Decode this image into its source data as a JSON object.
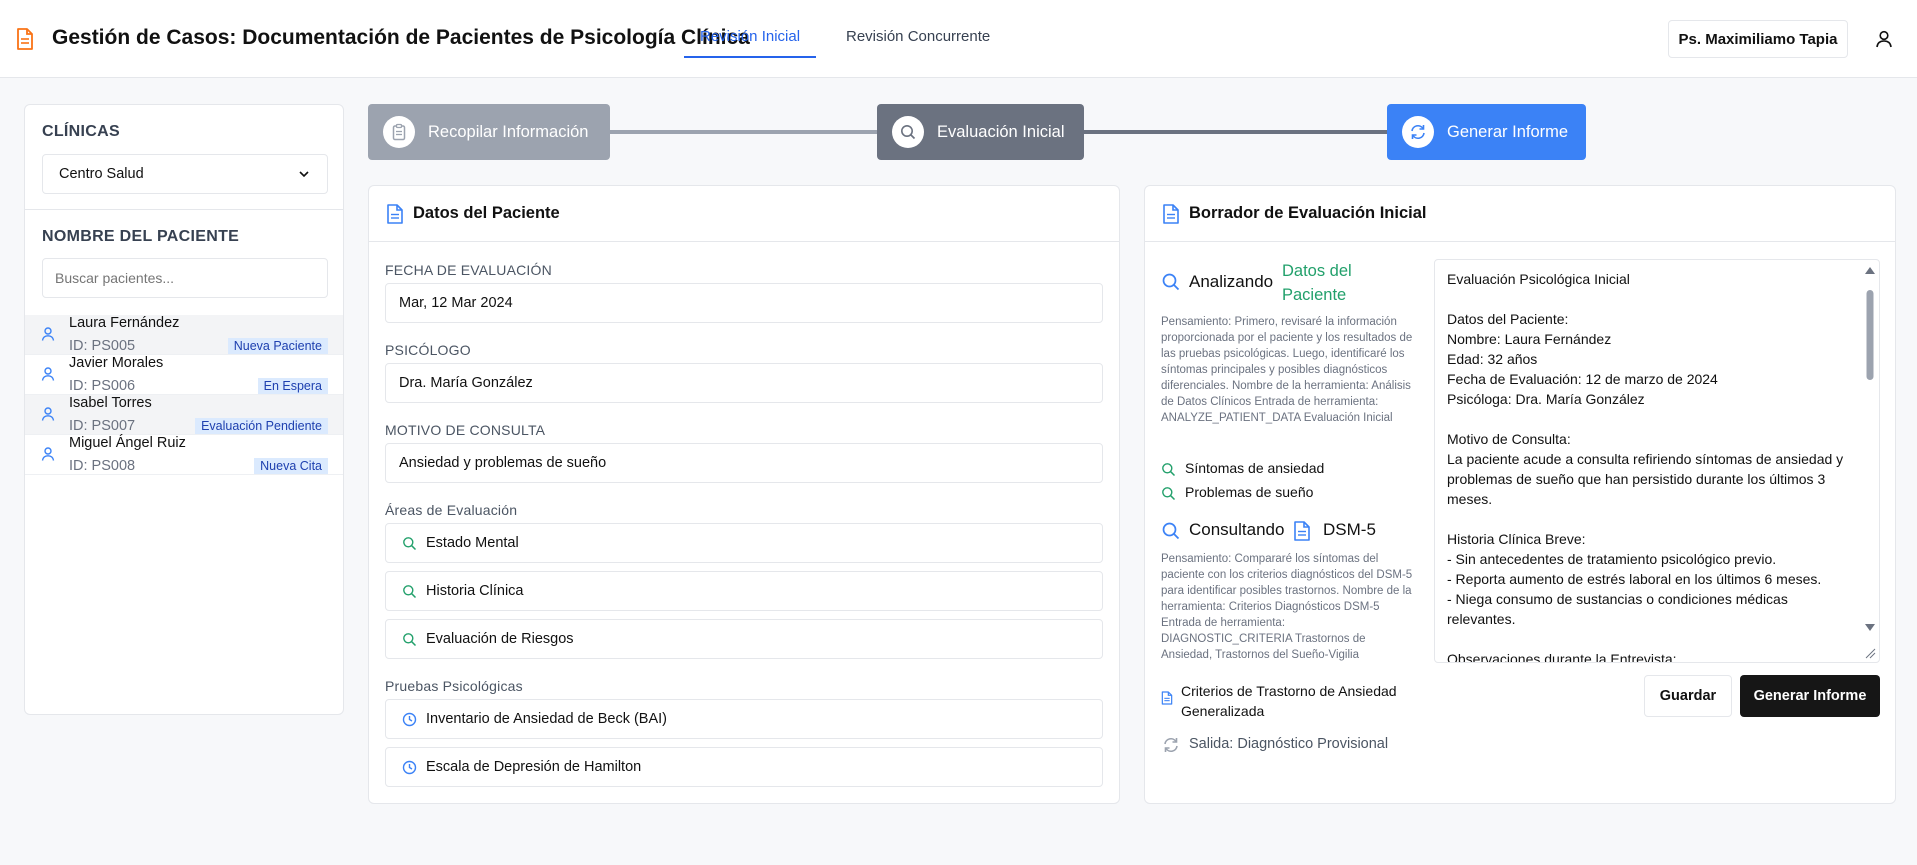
{
  "header": {
    "title": "Gestión de Casos: Documentación de Pacientes de Psicología Clínica",
    "tabs": [
      {
        "label": "Revisión Inicial",
        "active": true
      },
      {
        "label": "Revisión Concurrente",
        "active": false
      }
    ],
    "user_label": "Ps. Maximiliamo Tapia",
    "icons": {
      "app": "document-icon",
      "user": "user-icon"
    }
  },
  "sidebar": {
    "clinics_heading": "CLÍNICAS",
    "clinic_selected": "Centro Salud",
    "patient_heading": "NOMBRE DEL PACIENTE",
    "search_placeholder": "Buscar pacientes...",
    "patients": [
      {
        "name": "Laura Fernández",
        "id": "ID: PS005",
        "status": "Nueva Paciente"
      },
      {
        "name": "Javier Morales",
        "id": "ID: PS006",
        "status": "En Espera"
      },
      {
        "name": "Isabel Torres",
        "id": "ID: PS007",
        "status": "Evaluación Pendiente"
      },
      {
        "name": "Miguel Ángel Ruiz",
        "id": "ID: PS008",
        "status": "Nueva Cita"
      }
    ]
  },
  "stepper": {
    "steps": [
      {
        "label": "Recopilar Información",
        "icon": "clipboard-icon",
        "color": "#9ca3af"
      },
      {
        "label": "Evaluación Inicial",
        "icon": "search-icon",
        "color": "#6b7280"
      },
      {
        "label": "Generar Informe",
        "icon": "refresh-icon",
        "color": "#3b82f6"
      }
    ]
  },
  "patient_card": {
    "title": "Datos del Paciente",
    "fecha_label": "FECHA DE EVALUACIÓN",
    "fecha_value": "Mar, 12 Mar 2024",
    "psicologo_label": "PSICÓLOGO",
    "psicologo_value": "Dra. María González",
    "motivo_label": "MOTIVO DE CONSULTA",
    "motivo_value": "Ansiedad y problemas de sueño",
    "areas_label": "Áreas de Evaluación",
    "areas": [
      "Estado Mental",
      "Historia Clínica",
      "Evaluación de Riesgos"
    ],
    "pruebas_label": "Pruebas Psicológicas",
    "pruebas": [
      "Inventario de Ansiedad de Beck (BAI)",
      "Escala de Depresión de Hamilton"
    ]
  },
  "draft_card": {
    "title": "Borrador de Evaluación Inicial",
    "trace1": {
      "verb": "Analizando",
      "source_line1": "Datos del",
      "source_line2": "Paciente",
      "text": "Pensamiento: Primero, revisaré la información proporcionada por el paciente y los resultados de las pruebas psicológicas. Luego, identificaré los síntomas principales y posibles diagnósticos diferenciales. Nombre de la herramienta: Análisis de Datos Clínicos Entrada de herramienta: ANALYZE_PATIENT_DATA Evaluación Inicial",
      "findings": [
        "Síntomas de ansiedad",
        "Problemas de sueño"
      ]
    },
    "trace2": {
      "verb": "Consultando",
      "source": "DSM-5",
      "text": "Pensamiento: Compararé los síntomas del paciente con los criterios diagnósticos del DSM-5 para identificar posibles trastornos. Nombre de la herramienta: Criterios Diagnósticos DSM-5 Entrada de herramienta: DIAGNOSTIC_CRITERIA Trastornos de Ansiedad, Trastornos del Sueño-Vigilia",
      "doc_line1": "Criterios de Trastorno de Ansiedad",
      "doc_line2": "Generalizada",
      "output": "Salida: Diagnóstico Provisional"
    },
    "draft_text": "Evaluación Psicológica Inicial\n\nDatos del Paciente:\nNombre: Laura Fernández\nEdad: 32 años\nFecha de Evaluación: 12 de marzo de 2024\nPsicóloga: Dra. María González\n\nMotivo de Consulta:\nLa paciente acude a consulta refiriendo síntomas de ansiedad y problemas de sueño que han persistido durante los últimos 3 meses.\n\nHistoria Clínica Breve:\n- Sin antecedentes de tratamiento psicológico previo.\n- Reporta aumento de estrés laboral en los últimos 6 meses.\n- Niega consumo de sustancias o condiciones médicas relevantes.\n\nObservaciones durante la Entrevista:",
    "save_label": "Guardar",
    "generate_label": "Generar Informe"
  },
  "colors": {
    "accent": "#2563eb",
    "green": "#22a06b",
    "badge_bg": "#dbeafe",
    "primary_button": "#161616"
  }
}
